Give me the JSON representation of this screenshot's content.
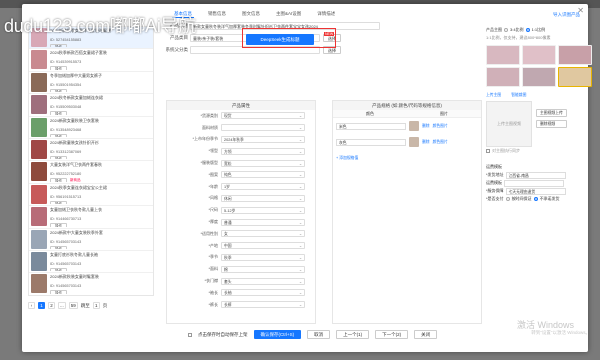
{
  "watermark": "dudu123.com嘟嘟Ai导航",
  "tabs": [
    "基本信息",
    "销售信息",
    "图文信息",
    "主图&AI设图",
    "详情描述"
  ],
  "top_right_link": "导入识图产品",
  "left_list": [
    {
      "title": "2024新款秋季女童洋气套装时髦潮",
      "id": "ID: 527454155883",
      "op": "操作",
      "color": "#d8a8b6"
    },
    {
      "title": "2024秋季新款百搭女童裙子套装",
      "id": "ID: 914539915573",
      "op": "操作",
      "color": "#c98a90"
    },
    {
      "title": "冬季加绒加厚中大童男女裤子",
      "id": "ID: 915501954354",
      "op": "操作",
      "color": "#8a6a58"
    },
    {
      "title": "2024秋冬新款女童加绒连衣裙",
      "id": "ID: 915509503048",
      "op": "操作",
      "color": "#9f6f7d"
    },
    {
      "title": "2024新款女童秋装卫衣套装",
      "id": "ID: 913548923468",
      "op": "操作",
      "color": "#6b9f6a"
    },
    {
      "title": "2024新款童装女孩针织开衫",
      "id": "ID: 913312387069",
      "op": "操作",
      "color": "#a04846"
    },
    {
      "title": "大童女装洋气卫衣两件套春秋",
      "id": "ID: 952222752180",
      "op": "操作",
      "tag": "新商品",
      "color": "#8e4a3c"
    },
    {
      "title": "2024秋季女童连衣裙宝宝公主裙",
      "id": "ID: 956191515713",
      "op": "操作",
      "color": "#c75a5a"
    },
    {
      "title": "女童加绒卫衣秋冬款儿童上衣",
      "id": "ID: 914466730713",
      "op": "操作",
      "color": "#b86c78"
    },
    {
      "title": "2024新款中大童女装秋季外套",
      "id": "ID: 914565703143",
      "op": "操作",
      "color": "#9aa6b6"
    },
    {
      "title": "女童打底衫秋冬款儿童长袖",
      "id": "ID: 914565703143",
      "op": "操作",
      "color": "#7a8a9c"
    },
    {
      "title": "2024新款秋装女童时髦套装",
      "id": "ID: 914565703143",
      "op": "操作",
      "color": "#9c7a6a"
    }
  ],
  "pager": {
    "prev": "‹",
    "pages": [
      "1",
      "2",
      "...",
      "59"
    ],
    "next_label": "跳至",
    "goto": "1",
    "unit": "页"
  },
  "form": {
    "title_label": "产品标题",
    "title_value": "新款女童秋冬装洋气加厚套装冬季时髦针织衫卫衣两件套宝宝女孩2024",
    "category_label": "产品类目",
    "category_value": "童装/亲子装/套装",
    "category_btn": "选择",
    "brand_label": "系统父分类",
    "brand_btn": "选择",
    "deepseek_btn": "DeepSeek生成标题",
    "deepseek_badge": "NEW"
  },
  "attrs": {
    "heading": "产品属性",
    "rows": [
      {
        "label": "*货源类别",
        "value": "现货"
      },
      {
        "label": "面料材质",
        "value": ""
      },
      {
        "label": "*上市年份季节",
        "value": "2024年秋季"
      },
      {
        "label": "*领型",
        "value": "方领"
      },
      {
        "label": "*服装版型",
        "value": "宽松"
      },
      {
        "label": "*图案",
        "value": "纯色"
      },
      {
        "label": "*年龄",
        "value": "1岁"
      },
      {
        "label": "*风格",
        "value": "休闲"
      },
      {
        "label": "*尺码",
        "value": "5-12岁"
      },
      {
        "label": "*厚度",
        "value": "普通"
      },
      {
        "label": "*适用性别",
        "value": "女"
      },
      {
        "label": "*产地",
        "value": "中国"
      },
      {
        "label": "*季节",
        "value": "秋季"
      },
      {
        "label": "*面料",
        "value": "棉"
      },
      {
        "label": "*衣门襟",
        "value": "套头"
      },
      {
        "label": "*袖长",
        "value": "长袖"
      },
      {
        "label": "*裤长",
        "value": "长裤"
      }
    ]
  },
  "sku": {
    "heading": "产品规格 (如:颜色/尺码等规格信息)",
    "col1": "颜色",
    "col2": "图片",
    "rows": [
      {
        "value": "米色",
        "del": "删除",
        "img": "颜色图片"
      },
      {
        "value": "灰色",
        "del": "删除",
        "img": "颜色图片"
      }
    ],
    "add": "+ 添加规格值"
  },
  "right": {
    "main_img_label": "产品主图",
    "opt_a": "3:4比例",
    "opt_b": "1:1比例",
    "hint": "1:1比例，仅支持，建议800*800像素",
    "upload_label": "上传主图",
    "crop_label": "智能裁图",
    "video_label": "上传主图视频",
    "video_btn1": "主图视频上传",
    "video_btn2": "删除视频",
    "checkbox_note": "对主图执行同步",
    "stock_title": "运费模板",
    "ship_label": "*发货地址",
    "ship_value": "江西省-南昌",
    "tmpl_label": "运费模板",
    "tmpl_value": "",
    "svc_label": "*服务保障",
    "svc_value": "七天无理由退货",
    "pay_label": "*是否支付",
    "pay_yes": "按时间保证",
    "pay_no": "不承诺发货"
  },
  "footer": {
    "check_label": "点击保存时自动保存上架",
    "save": "确认保存(Ctrl+S)",
    "cancel": "取消",
    "prev": "上一个(1)",
    "next": "下一个(2)",
    "close": "关闭"
  },
  "winmark": "激活 Windows",
  "winmark2": "转到\"设置\"以激活 Windows。",
  "colors": {
    "accent": "#1677ff",
    "highlight_border": "#e33333"
  }
}
